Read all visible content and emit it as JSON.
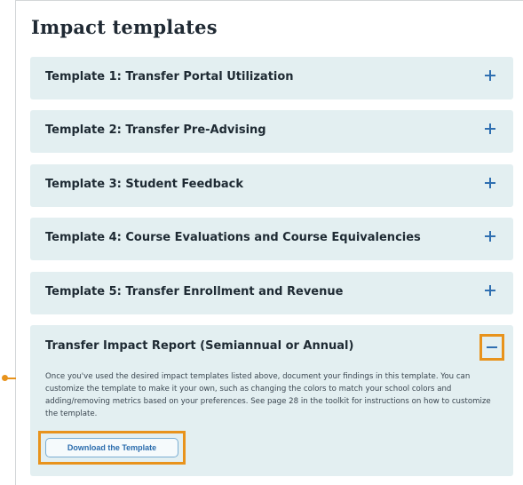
{
  "page": {
    "title": "Impact templates"
  },
  "accordions": [
    {
      "label": "Template 1: Transfer Portal Utilization",
      "icon": "plus-icon"
    },
    {
      "label": "Template 2: Transfer Pre-Advising",
      "icon": "plus-icon"
    },
    {
      "label": "Template 3: Student Feedback",
      "icon": "plus-icon"
    },
    {
      "label": "Template 4: Course Evaluations and Course Equivalencies",
      "icon": "plus-icon"
    },
    {
      "label": "Template 5: Transfer Enrollment and Revenue",
      "icon": "plus-icon"
    }
  ],
  "open_panel": {
    "label": "Transfer Impact Report (Semiannual or Annual)",
    "icon": "minus-icon",
    "body": "Once you've used the desired impact templates listed above, document your findings in this template. You can customize the template to make it your own, such as changing the colors to match your school colors and adding/removing metrics based on your preferences. See page 28 in the toolkit for instructions on how to customize the template.",
    "button_label": "Download the Template"
  },
  "colors": {
    "accent_highlight": "#e8931c",
    "panel_bg": "#e3eff1",
    "icon_blue": "#2f6fb1"
  }
}
